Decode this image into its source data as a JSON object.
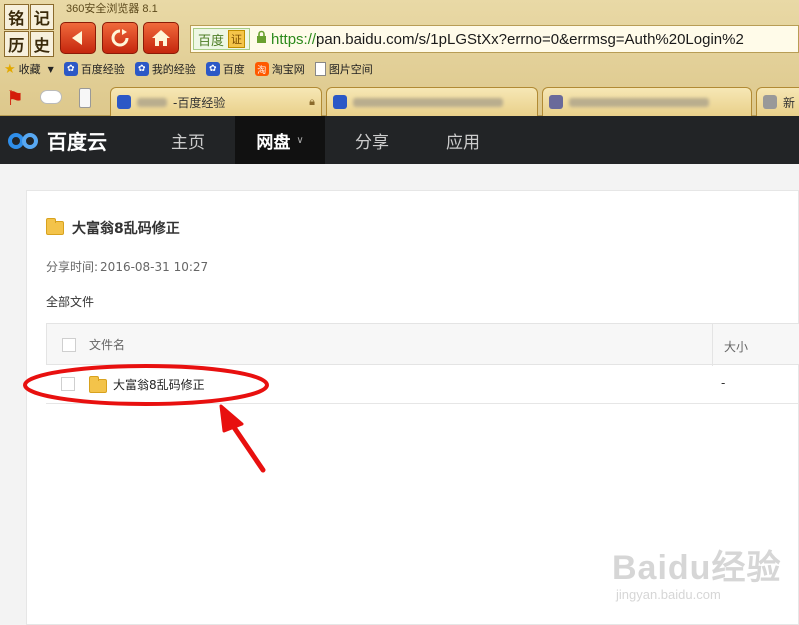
{
  "browser": {
    "title": "360安全浏览器 8.1",
    "logo_chars": [
      "铭",
      "记",
      "历",
      "史"
    ],
    "address": {
      "site_label": "百度",
      "cert_label": "证",
      "url_scheme": "https://",
      "url_host": "pan.baidu.com",
      "url_path": "/s/1pLGStXx?errno=0&errmsg=Auth%20Login%2"
    },
    "bookmarks": [
      {
        "label": "收藏",
        "icon": "star-icon"
      },
      {
        "label": "百度经验",
        "icon": "baidu-paw-icon"
      },
      {
        "label": "我的经验",
        "icon": "baidu-paw-icon"
      },
      {
        "label": "百度",
        "icon": "baidu-paw-icon"
      },
      {
        "label": "淘宝网",
        "icon": "taobao-icon"
      },
      {
        "label": "图片空间",
        "icon": "page-icon"
      }
    ],
    "tabs": [
      {
        "label": "-百度经验"
      },
      {
        "label": ""
      },
      {
        "label": ""
      },
      {
        "label": "新"
      }
    ]
  },
  "nav": {
    "brand": "百度云",
    "items": [
      "主页",
      "网盘",
      "分享",
      "应用"
    ]
  },
  "share": {
    "title": "大富翁8乱码修正",
    "time_label": "分享时间:",
    "time_value": "2016-08-31 10:27",
    "breadcrumb": "全部文件"
  },
  "table": {
    "columns": {
      "name": "文件名",
      "size": "大小"
    },
    "rows": [
      {
        "name": "大富翁8乱码修正",
        "size": "-"
      }
    ]
  },
  "watermark": {
    "brand": "Baidu经验",
    "url": "jingyan.baidu.com"
  },
  "colors": {
    "annotation": "#e8100f",
    "nav_bg": "#222426",
    "brand_blue": "#2f8ee9"
  }
}
